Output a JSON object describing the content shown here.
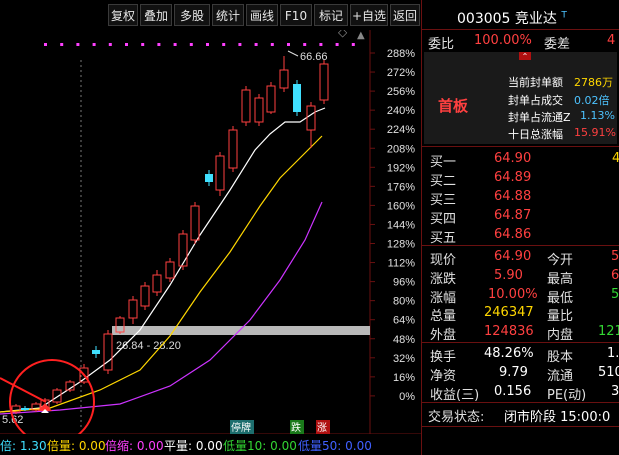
{
  "toolbar": {
    "items": [
      "复权",
      "叠加",
      "多股",
      "统计",
      "画线",
      "F10",
      "标记",
      "+自选",
      "返回"
    ]
  },
  "stock": {
    "code": "003005",
    "name": "竞业达",
    "badge": "T"
  },
  "ratio_row": {
    "weibi_label": "委比",
    "weibi_value": "100.00%",
    "weicha_label": "委差",
    "weicha_value": "4"
  },
  "limit_panel": {
    "tag": "首板",
    "rows": [
      {
        "label": "当前封单额",
        "value": "2786万"
      },
      {
        "label": "封单占成交",
        "value": "0.02倍"
      },
      {
        "label": "封单占流通Z",
        "value": "1.13%"
      },
      {
        "label": "十日总涨幅",
        "value": "15.91%"
      }
    ],
    "toggle_glyph": "⌃"
  },
  "orderbook": {
    "rows": [
      {
        "label": "买一",
        "price": "64.90",
        "vol": "4"
      },
      {
        "label": "买二",
        "price": "64.89",
        "vol": ""
      },
      {
        "label": "买三",
        "price": "64.88",
        "vol": ""
      },
      {
        "label": "买四",
        "price": "64.87",
        "vol": ""
      },
      {
        "label": "买五",
        "price": "64.86",
        "vol": ""
      }
    ]
  },
  "quote": {
    "rows": [
      {
        "l1": "现价",
        "v1": "64.90",
        "l2": "今开",
        "v2": "5"
      },
      {
        "l1": "涨跌",
        "v1": "5.90",
        "l2": "最高",
        "v2": "6"
      },
      {
        "l1": "涨幅",
        "v1": "10.00%",
        "l2": "最低",
        "v2": "5"
      },
      {
        "l1": "总量",
        "v1": "246347",
        "l2": "量比",
        "v2": ""
      },
      {
        "l1": "外盘",
        "v1": "124836",
        "l2": "内盘",
        "v2": "121"
      }
    ]
  },
  "fundamentals": {
    "rows": [
      {
        "l1": "换手",
        "v1": "48.26%",
        "l2": "股本",
        "v2": "1."
      },
      {
        "l1": "净资",
        "v1": "9.79",
        "l2": "流通",
        "v2": "510"
      },
      {
        "l1": "收益(三)",
        "v1": "0.156",
        "l2": "PE(动)",
        "v2": "3"
      }
    ]
  },
  "status": {
    "label": "交易状态:",
    "value": "闭市阶段 15:00:0"
  },
  "chart": {
    "yaxis_labels": [
      "288%",
      "272%",
      "256%",
      "240%",
      "224%",
      "208%",
      "192%",
      "176%",
      "160%",
      "144%",
      "128%",
      "112%",
      "96%",
      "80%",
      "64%",
      "48%",
      "32%",
      "16%",
      "0%"
    ],
    "high_label": "66.66",
    "low_label": "5.62",
    "range_label": "26.84 - 28.20",
    "markers": [
      "停牌",
      "跌",
      "涨"
    ]
  },
  "indicators": {
    "items": [
      {
        "text": "倍: 1.30",
        "color": "#40e0ff"
      },
      {
        "text": "倍量: 0.00",
        "color": "#ffd700"
      },
      {
        "text": "倍缩: 0.00",
        "color": "#ff40ff"
      },
      {
        "text": "平量: 0.00",
        "color": "#ffffff"
      },
      {
        "text": "低量10: 0.00",
        "color": "#33d633"
      },
      {
        "text": "低量50: 0.00",
        "color": "#4060ff"
      }
    ]
  },
  "colors": {
    "up": "#ff4040",
    "down": "#40e0ff",
    "ma_white": "#ffffff",
    "ma_yellow": "#ffd700",
    "ma_purple": "#cc33ff",
    "grid_red": "#6a1010",
    "limit_panel_bg": "#1a1a1a"
  }
}
